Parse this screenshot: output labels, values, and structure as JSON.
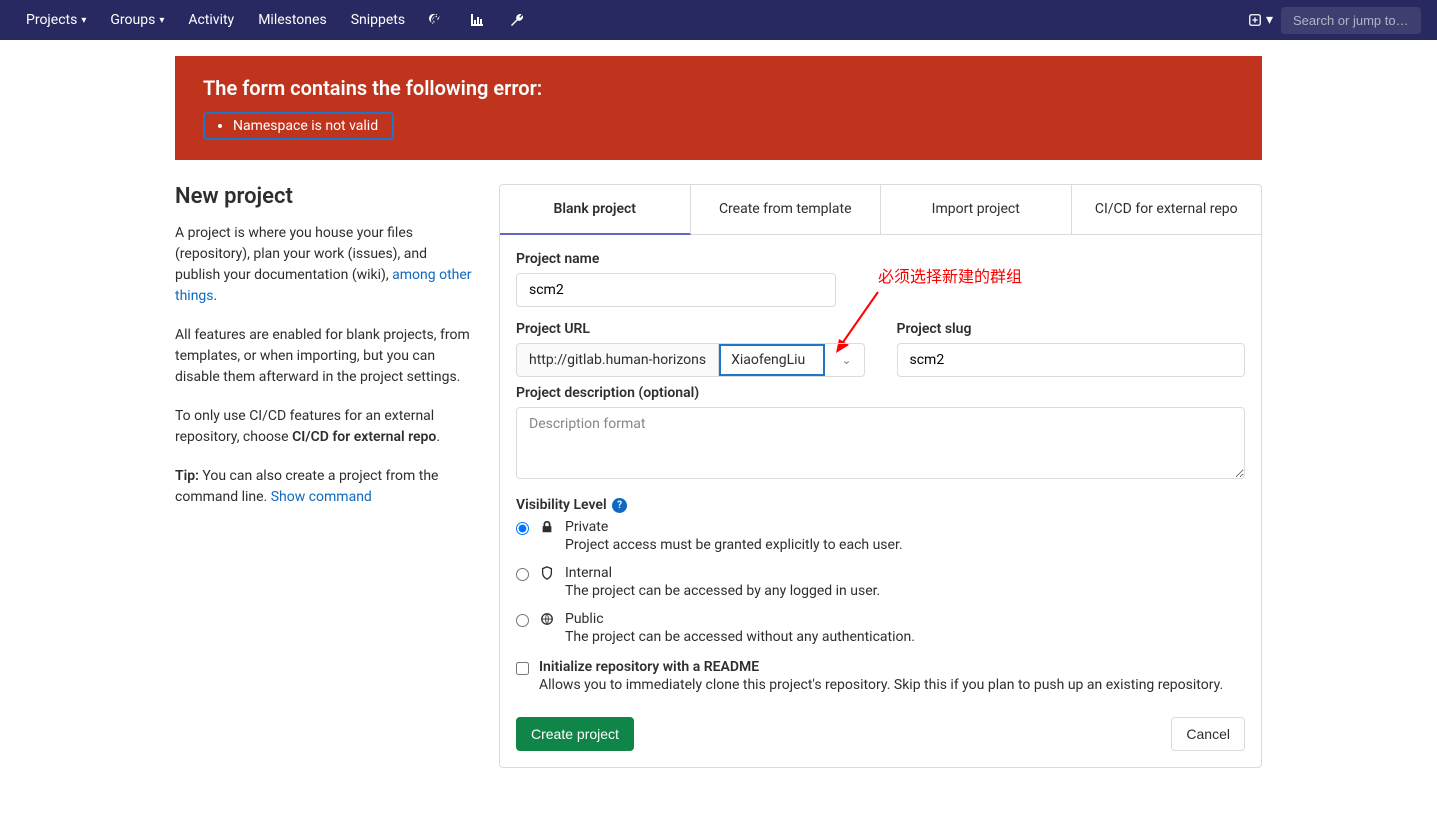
{
  "nav": {
    "projects": "Projects",
    "groups": "Groups",
    "activity": "Activity",
    "milestones": "Milestones",
    "snippets": "Snippets",
    "search_placeholder": "Search or jump to…"
  },
  "alert": {
    "title": "The form contains the following error:",
    "errors": [
      "Namespace is not valid"
    ]
  },
  "sidebar": {
    "heading": "New project",
    "para1_a": "A project is where you house your files (repository), plan your work (issues), and publish your documentation (wiki), ",
    "para1_link": "among other things",
    "para1_b": ".",
    "para2": "All features are enabled for blank projects, from templates, or when importing, but you can disable them afterward in the project settings.",
    "para3_a": "To only use CI/CD features for an external repository, choose ",
    "para3_b": "CI/CD for external repo",
    "para3_c": ".",
    "tip_label": "Tip:",
    "tip_text": " You can also create a project from the command line. ",
    "tip_link": "Show command"
  },
  "tabs": {
    "blank": "Blank project",
    "template": "Create from template",
    "import": "Import project",
    "cicd": "CI/CD for external repo"
  },
  "form": {
    "project_name_label": "Project name",
    "project_name_value": "scm2",
    "project_url_label": "Project URL",
    "project_url_prefix": "http://gitlab.human-horizons",
    "namespace_value": "XiaofengLiu",
    "project_slug_label": "Project slug",
    "project_slug_value": "scm2",
    "desc_label": "Project description (optional)",
    "desc_placeholder": "Description format",
    "visibility_label": "Visibility Level",
    "vis_private_title": "Private",
    "vis_private_desc": "Project access must be granted explicitly to each user.",
    "vis_internal_title": "Internal",
    "vis_internal_desc": "The project can be accessed by any logged in user.",
    "vis_public_title": "Public",
    "vis_public_desc": "The project can be accessed without any authentication.",
    "readme_label": "Initialize repository with a README",
    "readme_desc": "Allows you to immediately clone this project's repository. Skip this if you plan to push up an existing repository.",
    "create_btn": "Create project",
    "cancel_btn": "Cancel"
  },
  "annotation": {
    "text": "必须选择新建的群组"
  }
}
